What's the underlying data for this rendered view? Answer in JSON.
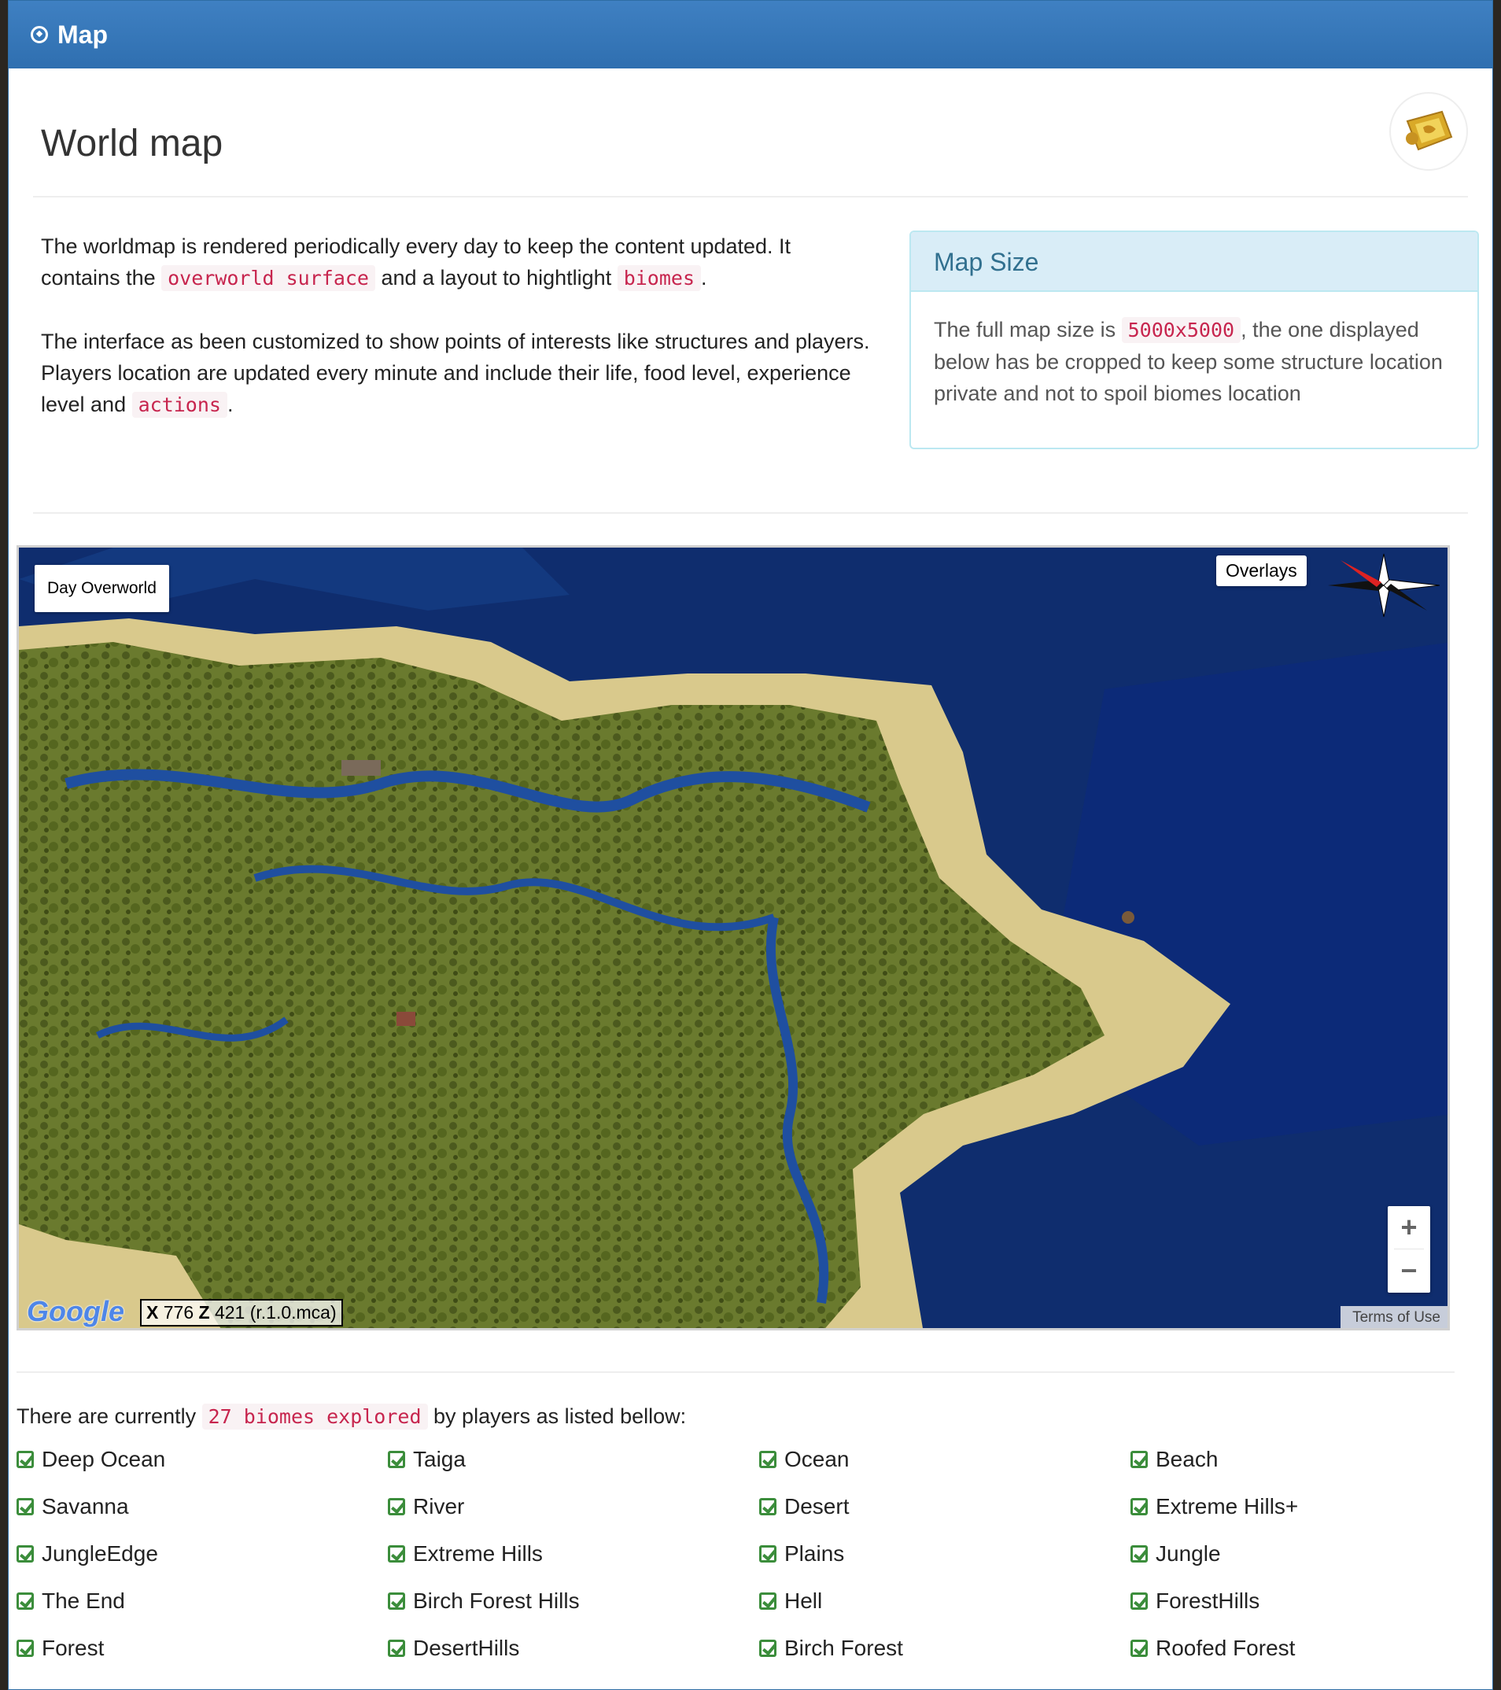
{
  "panel": {
    "title": "Map"
  },
  "header": {
    "title": "World map"
  },
  "intro": {
    "p1_a": "The worldmap is rendered periodically every day to keep the content updated. It contains the ",
    "p1_code1": "overworld surface",
    "p1_b": " and a layout to hightlight ",
    "p1_code2": "biomes",
    "p1_c": ".",
    "p2_a": "The interface as been customized to show points of interests like structures and players. Players location are updated every minute and include their life, food level, experience level and ",
    "p2_code": "actions",
    "p2_b": "."
  },
  "info": {
    "title": "Map Size",
    "body_a": "The full map size is ",
    "body_code": "5000x5000",
    "body_b": ", the one displayed below has be cropped to keep some structure location private and not to spoil biomes location"
  },
  "map": {
    "layer_button": "Day Overworld",
    "overlays_button": "Overlays",
    "zoom_in": "+",
    "zoom_out": "−",
    "google_logo": "Google",
    "coord_x_label": "X",
    "coord_x": "776",
    "coord_z_label": "Z",
    "coord_z": "421",
    "coord_region": "(r.1.0.mca)",
    "terms": "Terms of Use"
  },
  "biomes": {
    "intro_a": "There are currently ",
    "intro_code": "27 biomes explored",
    "intro_b": " by players as listed bellow:",
    "items": [
      "Deep Ocean",
      "Taiga",
      "Ocean",
      "Beach",
      "Savanna",
      "River",
      "Desert",
      "Extreme Hills+",
      "JungleEdge",
      "Extreme Hills",
      "Plains",
      "Jungle",
      "The End",
      "Birch Forest Hills",
      "Hell",
      "ForestHills",
      "Forest",
      "DesertHills",
      "Birch Forest",
      "Roofed Forest"
    ]
  },
  "colors": {
    "heading_blue": "#3a7bbf",
    "ocean": "#0f2d6e",
    "land": "#5d6b2a",
    "sand": "#d9c98c",
    "code_red": "#c7254e",
    "check_green": "#3b8d3b"
  }
}
